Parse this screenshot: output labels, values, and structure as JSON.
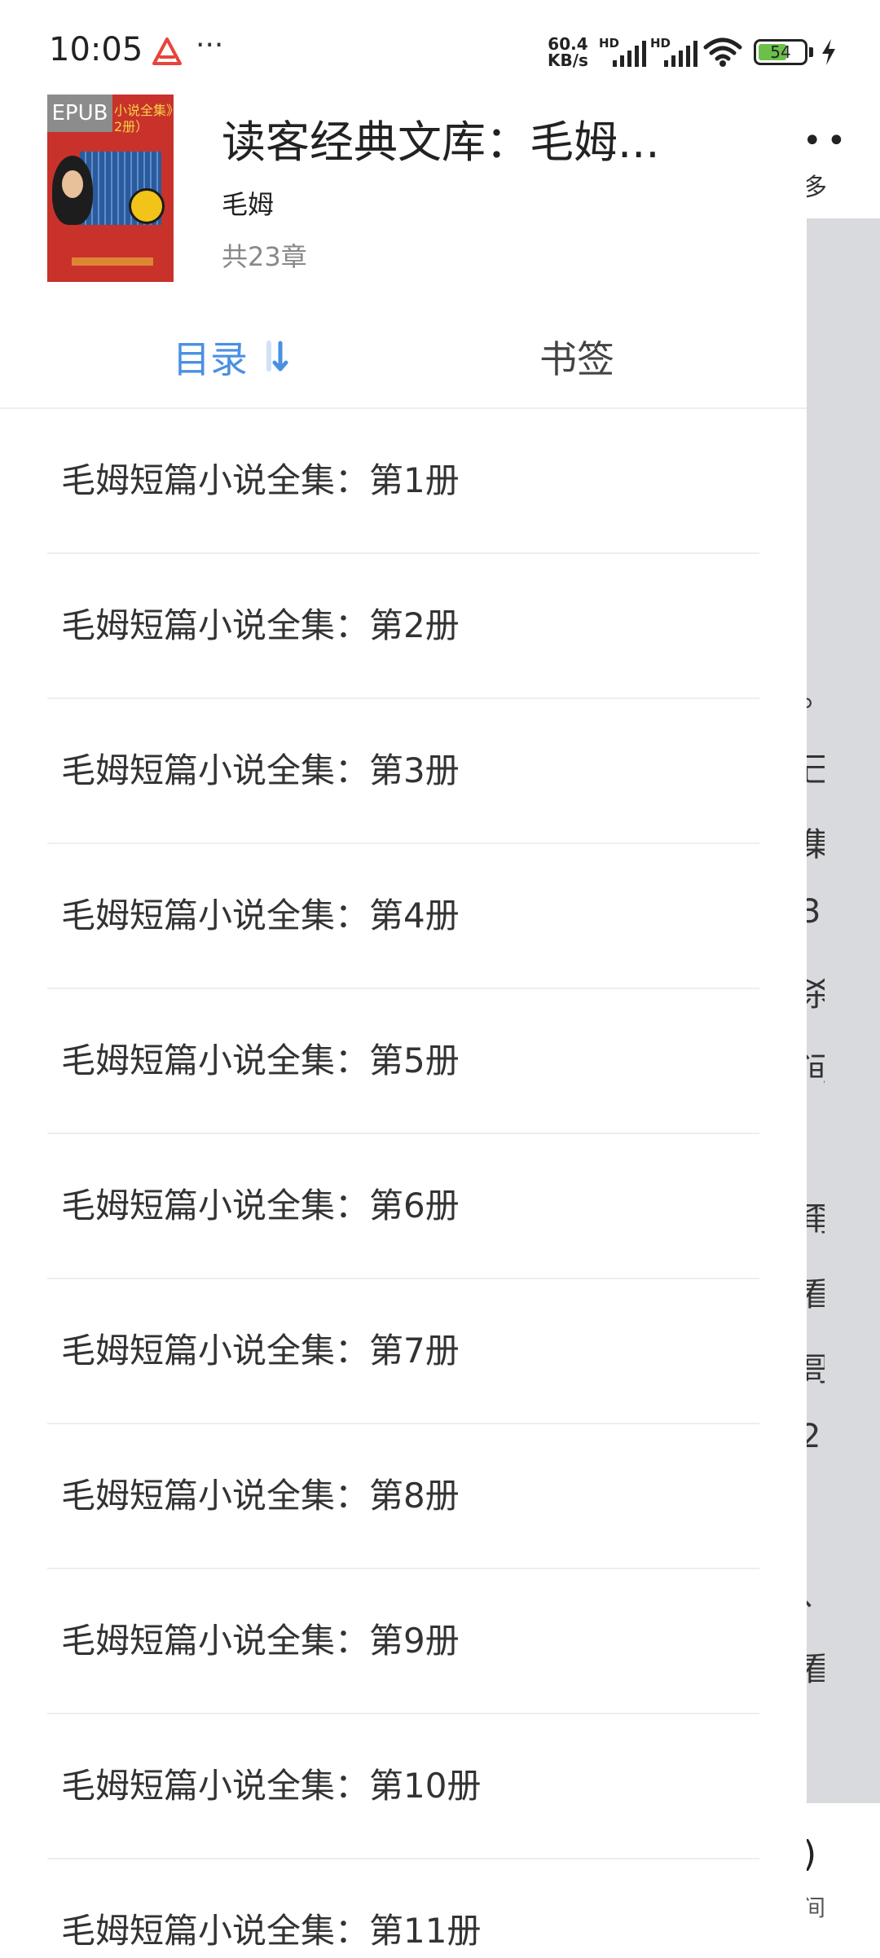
{
  "status_bar": {
    "time": "10:05",
    "menu_dots": "···",
    "net_speed_value": "60.4",
    "net_speed_unit": "KB/s",
    "hd_label": "HD",
    "battery_level": "54",
    "colors": {
      "battery_fill": "#6cc04a"
    }
  },
  "book": {
    "cover_badge": "EPUB",
    "cover_text": "小说全集》",
    "cover_text2": "2册）",
    "title": "读客经典文库：毛姆...",
    "author": "毛姆",
    "chapter_count": "共23章"
  },
  "tabs": {
    "toc_label": "目录",
    "bookmarks_label": "书签",
    "active": "toc",
    "colors": {
      "active": "#4a90e2",
      "inactive": "#444444"
    }
  },
  "toc": {
    "items": [
      "毛姆短篇小说全集：第1册",
      "毛姆短篇小说全集：第2册",
      "毛姆短篇小说全集：第3册",
      "毛姆短篇小说全集：第4册",
      "毛姆短篇小说全集：第5册",
      "毛姆短篇小说全集：第6册",
      "毛姆短篇小说全集：第7册",
      "毛姆短篇小说全集：第8册",
      "毛姆短篇小说全集：第9册",
      "毛姆短篇小说全集：第10册",
      "毛姆短篇小说全集：第11册"
    ]
  },
  "background_page": {
    "top_dots": "••",
    "top_more": "多",
    "chars": [
      "。",
      "己",
      "集",
      "3",
      "杀",
      "间",
      "",
      "甭",
      "看",
      "哥",
      "2",
      "",
      "、",
      "看",
      "，"
    ],
    "bottom_char": ")",
    "bottom_char2": "间"
  }
}
